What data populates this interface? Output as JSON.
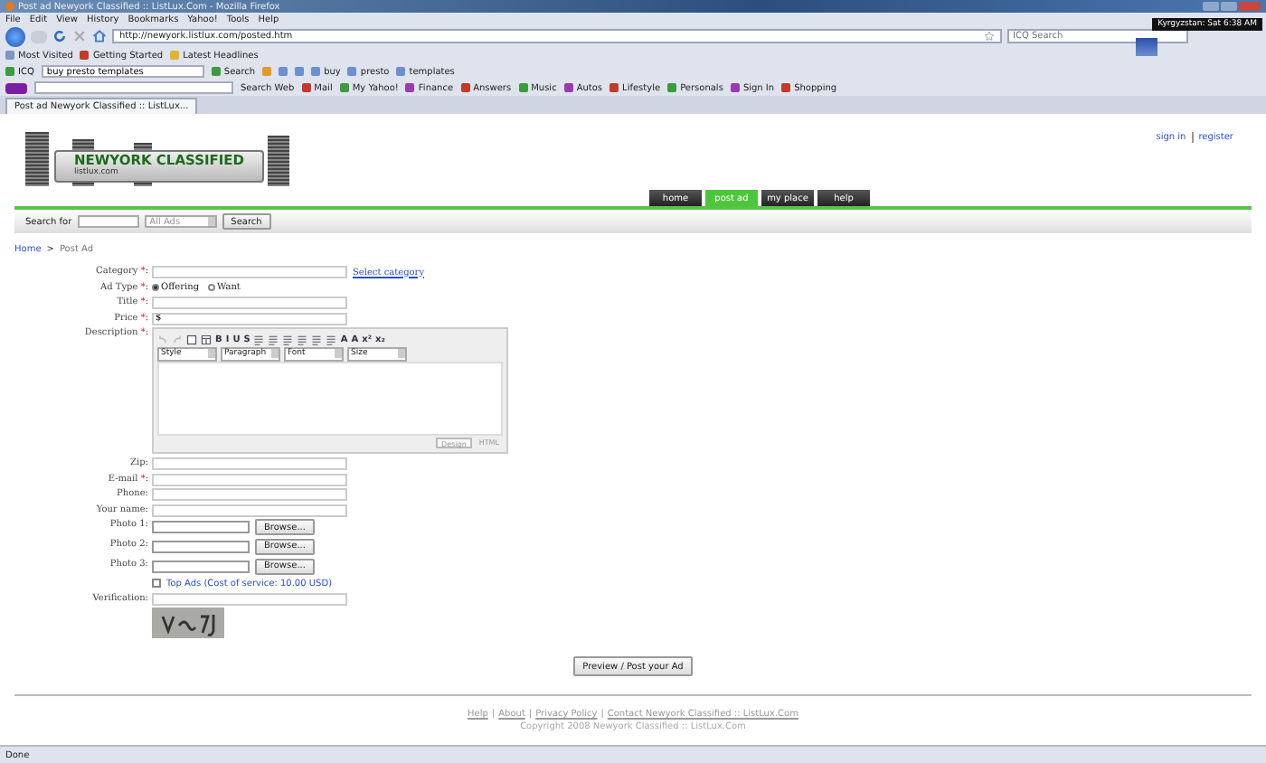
{
  "window": {
    "title": "Post ad Newyork Classified :: ListLux.Com - Mozilla Firefox"
  },
  "menu": [
    "File",
    "Edit",
    "View",
    "History",
    "Bookmarks",
    "Yahoo!",
    "Tools",
    "Help"
  ],
  "nav_bar": {
    "url": "http://newyork.listlux.com/posted.htm",
    "search_placeholder": "ICQ Search",
    "tooltip": "Kyrgyzstan: Sat 6:38 AM"
  },
  "bookmarks": [
    "Most Visited",
    "Getting Started",
    "Latest Headlines"
  ],
  "icq_toolbar": {
    "label": "ICQ",
    "query": "buy presto templates",
    "search": "Search",
    "terms": [
      "buy",
      "presto",
      "templates"
    ]
  },
  "yahoo_toolbar": {
    "search": "Search Web",
    "items": [
      "Mail",
      "My Yahoo!",
      "Finance",
      "Answers",
      "Music",
      "Autos",
      "Lifestyle",
      "Personals",
      "Sign In",
      "Shopping"
    ]
  },
  "tabs": [
    {
      "label": "Post ad Newyork Classified :: ListLux...",
      "selected": true
    }
  ],
  "site": {
    "logo": "NEWYORK CLASSIFIED",
    "logo_sub": "listlux.com",
    "account_links": [
      "sign in",
      "register"
    ],
    "nav": [
      {
        "label": "home",
        "selected": false
      },
      {
        "label": "post ad",
        "selected": true
      },
      {
        "label": "my place",
        "selected": false
      },
      {
        "label": "help",
        "selected": false
      }
    ],
    "search": {
      "label": "Search for",
      "scope": "All Ads",
      "button": "Search"
    },
    "breadcrumb": [
      {
        "label": "Home",
        "kind": "link"
      },
      {
        "label": ">",
        "kind": "separator"
      },
      {
        "label": "Post Ad",
        "kind": "current"
      }
    ]
  },
  "form": {
    "rows": [
      {
        "kind": "text",
        "label": "Category ",
        "required": "*:",
        "link": "Select category"
      },
      {
        "kind": "radio",
        "label": "Ad Type ",
        "required": "*:",
        "options": [
          {
            "label": "Offering",
            "selected": true
          },
          {
            "label": "Want",
            "selected": false
          }
        ]
      },
      {
        "kind": "text",
        "label": "Title ",
        "required": "*:"
      },
      {
        "kind": "text",
        "label": "Price ",
        "required": "*:",
        "value": "$"
      },
      {
        "kind": "editor",
        "label": "Description ",
        "required": "*:"
      },
      {
        "kind": "text",
        "label": "Zip:"
      },
      {
        "kind": "text",
        "label": "E-mail ",
        "required": "*:"
      },
      {
        "kind": "text",
        "label": "Phone:"
      },
      {
        "kind": "text",
        "label": "Your name:"
      },
      {
        "kind": "file",
        "label": "Photo 1:",
        "button": "Browse..."
      },
      {
        "kind": "file",
        "label": "Photo 2:",
        "button": "Browse..."
      },
      {
        "kind": "file",
        "label": "Photo 3:",
        "button": "Browse..."
      },
      {
        "kind": "checkbox",
        "text": "Top Ads (Cost of service: 10.00 USD)",
        "checked": false
      },
      {
        "kind": "text",
        "label": "Verification:"
      },
      {
        "kind": "captcha"
      }
    ],
    "editor": {
      "tools": [
        {
          "kind": "undo"
        },
        {
          "kind": "redo"
        },
        {
          "kind": "doc"
        },
        {
          "kind": "table"
        },
        {
          "kind": "text",
          "label": "B"
        },
        {
          "kind": "text",
          "label": "I"
        },
        {
          "kind": "text",
          "label": "U"
        },
        {
          "kind": "text",
          "label": "S"
        },
        {
          "kind": "align"
        },
        {
          "kind": "align"
        },
        {
          "kind": "align"
        },
        {
          "kind": "align"
        },
        {
          "kind": "align"
        },
        {
          "kind": "align"
        },
        {
          "kind": "text",
          "label": "A"
        },
        {
          "kind": "text",
          "label": "A"
        },
        {
          "kind": "text",
          "label": "x²"
        },
        {
          "kind": "text",
          "label": "x₂"
        }
      ],
      "selects": [
        "Style",
        "Paragraph",
        "Font",
        "Size"
      ],
      "modes": [
        {
          "label": "Design",
          "selected": true
        },
        {
          "label": "HTML",
          "selected": false
        }
      ]
    },
    "submit": "Preview / Post your Ad"
  },
  "footer": {
    "links": [
      "Help",
      "About",
      "Privacy Policy",
      "Contact Newyork Classified :: ListLux.Com"
    ],
    "separator": "|",
    "copyright": "Copyright 2008 Newyork Classified :: ListLux.Com"
  },
  "status_bar": {
    "text": "Done"
  }
}
